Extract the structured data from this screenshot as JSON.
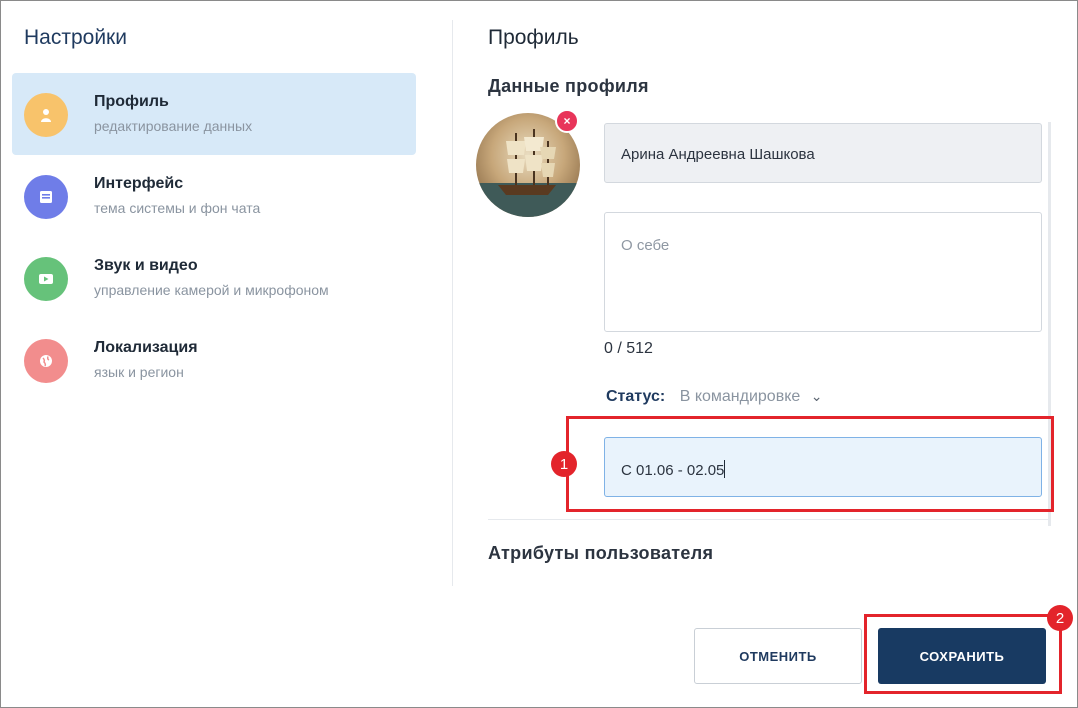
{
  "settings": {
    "title": "Настройки",
    "items": [
      {
        "label": "Профиль",
        "sub": "редактирование данных",
        "icon": "person-icon",
        "color": "#f8c36b",
        "active": true
      },
      {
        "label": "Интерфейс",
        "sub": "тема системы и фон чата",
        "icon": "interface-icon",
        "color": "#6f7de8",
        "active": false
      },
      {
        "label": "Звук и видео",
        "sub": "управление камерой и микрофоном",
        "icon": "video-icon",
        "color": "#66c27a",
        "active": false
      },
      {
        "label": "Локализация",
        "sub": "язык и регион",
        "icon": "globe-icon",
        "color": "#f28d8d",
        "active": false
      }
    ]
  },
  "profile": {
    "title": "Профиль",
    "section_title": "Данные профиля",
    "name_value": "Арина Андреевна Шашкова",
    "about_placeholder": "О себе",
    "counter": "0 / 512",
    "status_label": "Статус:",
    "status_value": "В командировке",
    "status_text_value": "С 01.06 - 02.05",
    "attributes_title": "Атрибуты пользователя"
  },
  "buttons": {
    "cancel": "ОТМЕНИТЬ",
    "save": "СОХРАНИТЬ"
  },
  "badges": {
    "first": "1",
    "second": "2"
  },
  "colors": {
    "accent_dark": "#183a62",
    "active_bg": "#d7e9f8",
    "highlight": "#e3242b"
  }
}
